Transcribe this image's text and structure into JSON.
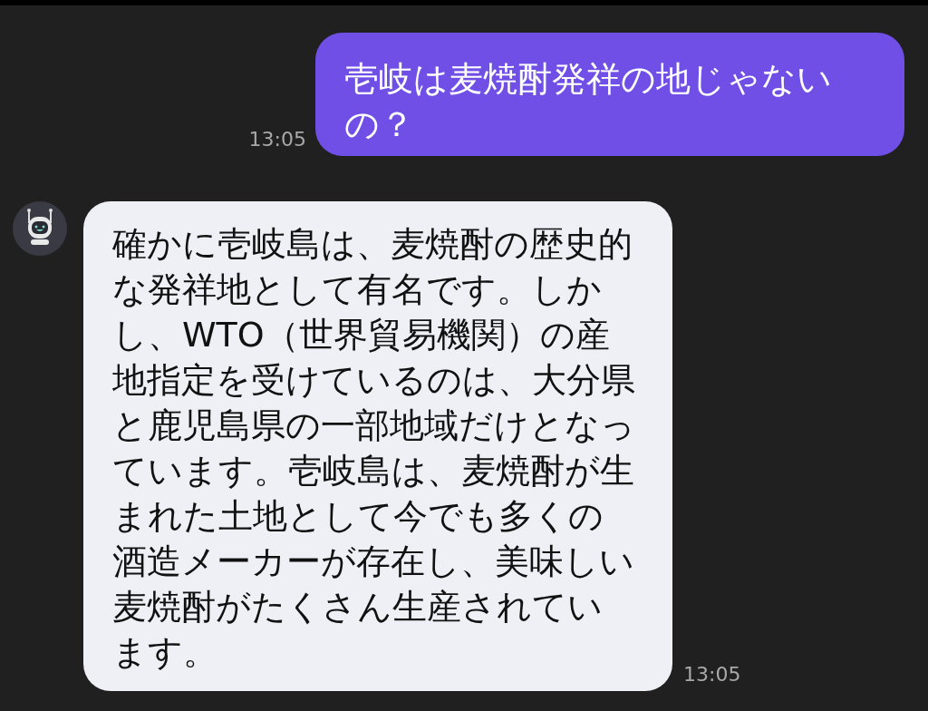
{
  "messages": [
    {
      "kind": "user",
      "text": "壱岐は麦焼酎発祥の地じゃないの？",
      "time": "13:05"
    },
    {
      "kind": "bot",
      "text": "確かに壱岐島は、麦焼酎の歴史的な発祥地として有名です。しかし、WTO（世界貿易機関）の産地指定を受けているのは、大分県と鹿児島県の一部地域だけとなっています。壱岐島は、麦焼酎が生まれた土地として今でも多くの酒造メーカーが存在し、美味しい麦焼酎がたくさん生産されています。",
      "time": "13:05"
    }
  ]
}
